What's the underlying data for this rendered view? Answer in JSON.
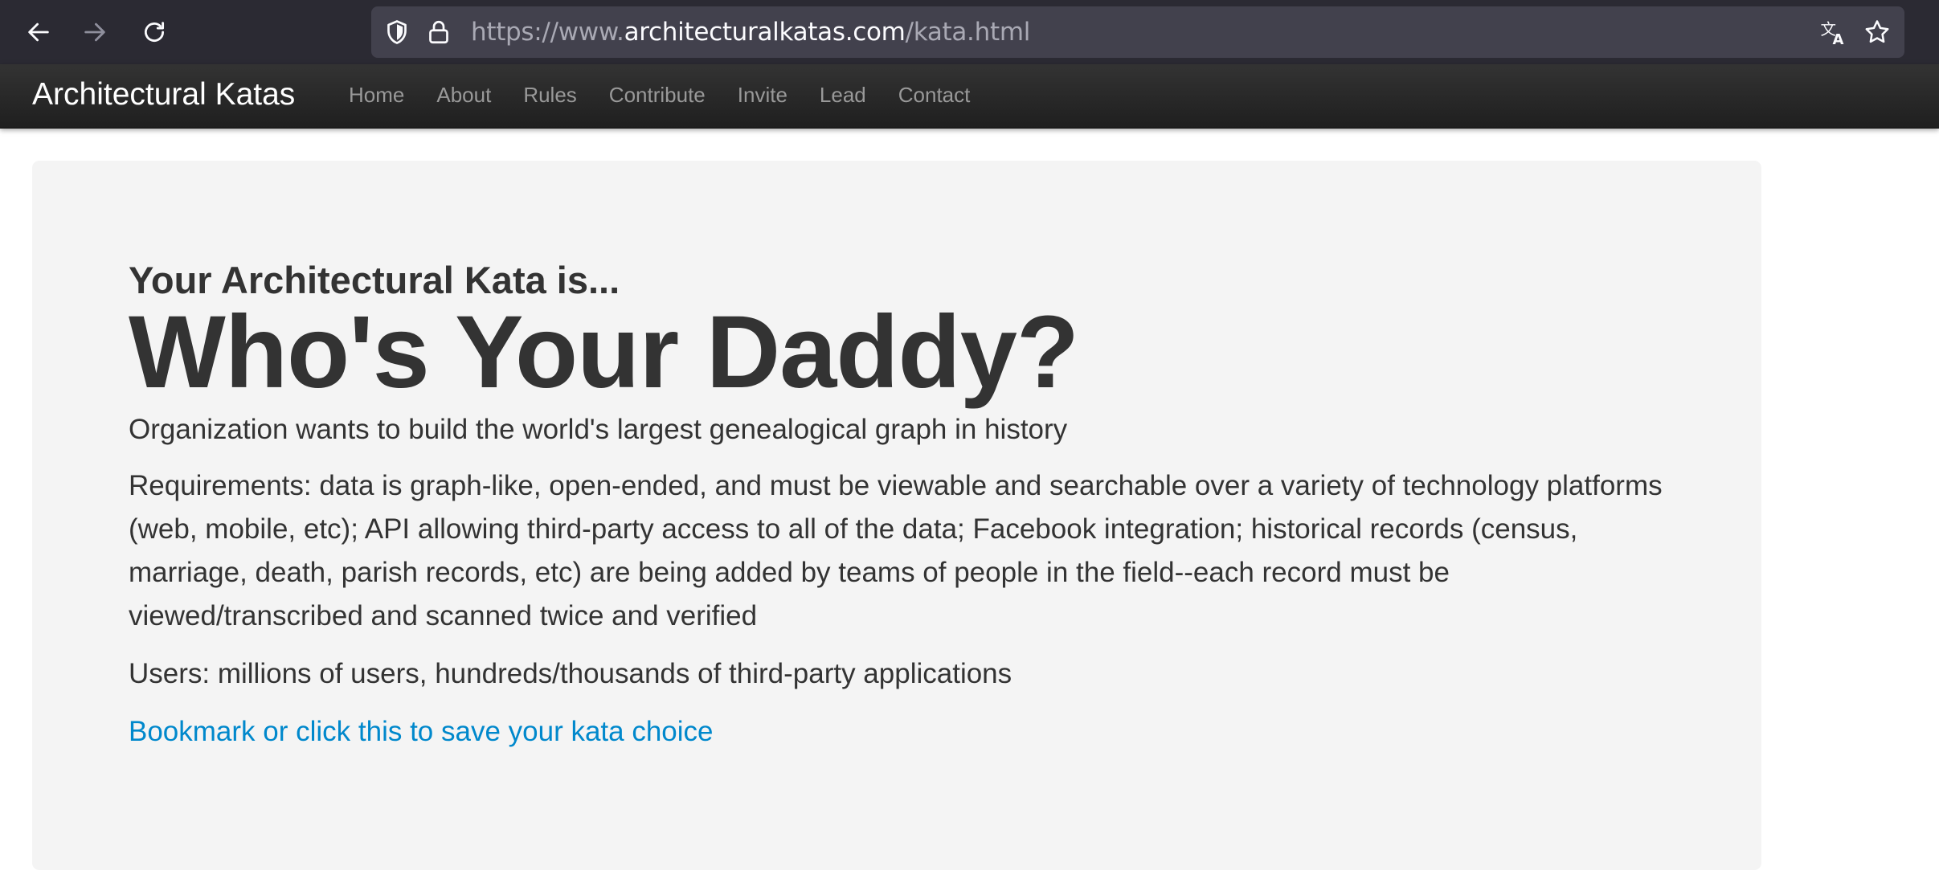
{
  "browser": {
    "url_prefix": "https://www.",
    "url_domain": "architecturalkatas.com",
    "url_path": "/kata.html"
  },
  "site_nav": {
    "brand": "Architectural Katas",
    "links": [
      "Home",
      "About",
      "Rules",
      "Contribute",
      "Invite",
      "Lead",
      "Contact"
    ]
  },
  "hero": {
    "kicker": "Your Architectural Kata is...",
    "title": "Who's Your Daddy?",
    "description": "Organization wants to build the world's largest genealogical graph in history",
    "requirements": "Requirements: data is graph-like, open-ended, and must be viewable and searchable over a variety of technology platforms (web, mobile, etc); API allowing third-party access to all of the data; Facebook integration; historical records (census, marriage, death, parish records, etc) are being added by teams of people in the field--each record must be viewed/transcribed and scanned twice and verified",
    "users": "Users: millions of users, hundreds/thousands of third-party applications",
    "bookmark_link": "Bookmark or click this to save your kata choice"
  },
  "colors": {
    "browser_chrome": "#2b2a33",
    "url_field": "#42414d",
    "navbar": "#222222",
    "hero_background": "#f4f4f4",
    "text": "#333333",
    "link": "#0088cc"
  }
}
